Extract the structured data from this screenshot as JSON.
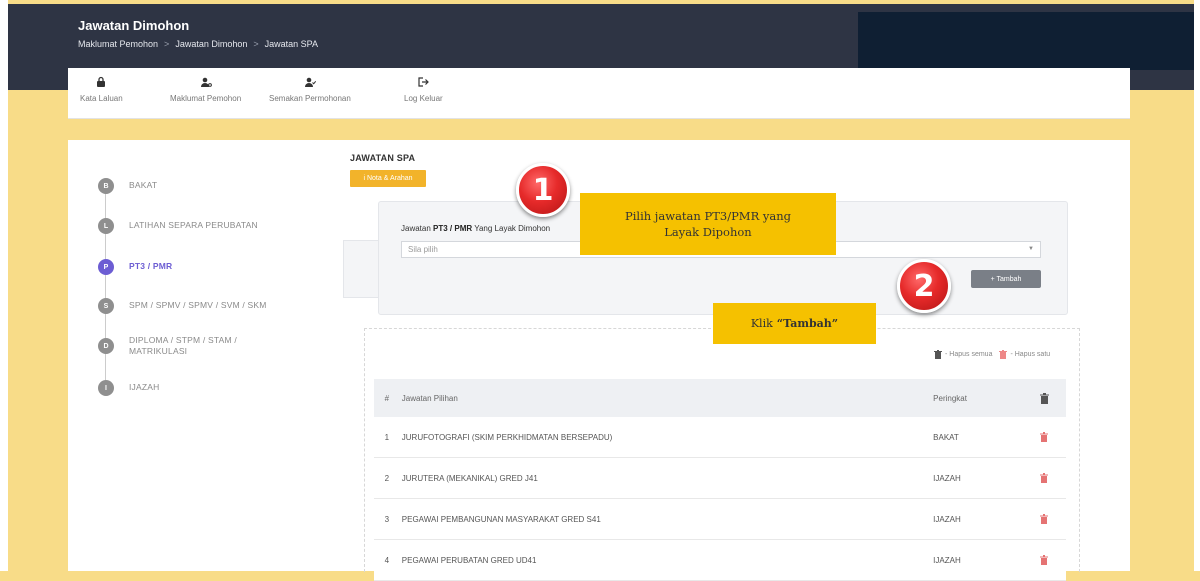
{
  "header": {
    "title": "Jawatan Dimohon",
    "breadcrumb": [
      "Maklumat Pemohon",
      "Jawatan Dimohon",
      "Jawatan SPA"
    ],
    "breadcrumb_separator": ">"
  },
  "nav": {
    "items": [
      {
        "label": "Kata Laluan",
        "icon": "lock-icon"
      },
      {
        "label": "Maklumat Pemohon",
        "icon": "user-settings-icon"
      },
      {
        "label": "Semakan Permohonan",
        "icon": "user-check-icon"
      },
      {
        "label": "Log Keluar",
        "icon": "logout-icon"
      }
    ]
  },
  "steps": [
    {
      "letter": "B",
      "label": "BAKAT"
    },
    {
      "letter": "L",
      "label": "LATIHAN SEPARA PERUBATAN"
    },
    {
      "letter": "P",
      "label": "PT3 / PMR",
      "active": true
    },
    {
      "letter": "S",
      "label": "SPM / SPMV / SPMV / SVM / SKM"
    },
    {
      "letter": "D",
      "label_line1": "DIPLOMA / STPM / STAM /",
      "label_line2": "MATRIKULASI"
    },
    {
      "letter": "I",
      "label": "IJAZAH"
    }
  ],
  "main": {
    "section_title": "JAWATAN SPA",
    "nota_button": "i Nota & Arahan",
    "field_label_prefix": "Jawatan ",
    "field_label_bold": "PT3 / PMR",
    "field_label_suffix": " Yang Layak Dimohon",
    "select_placeholder": "Sila pilih",
    "tambah_button": "+ Tambah"
  },
  "legend": {
    "hapus_semua": "- Hapus semua",
    "hapus_satu": "- Hapus satu"
  },
  "table": {
    "headers": {
      "no": "#",
      "name": "Jawatan Pilihan",
      "rank": "Peringkat"
    },
    "rows": [
      {
        "no": "1",
        "name": "JURUFOTOGRAFI (SKIM PERKHIDMATAN BERSEPADU)",
        "rank": "BAKAT"
      },
      {
        "no": "2",
        "name": "JURUTERA (MEKANIKAL) GRED J41",
        "rank": "IJAZAH"
      },
      {
        "no": "3",
        "name": "PEGAWAI PEMBANGUNAN MASYARAKAT GRED S41",
        "rank": "IJAZAH"
      },
      {
        "no": "4",
        "name": "PEGAWAI PERUBATAN GRED UD41",
        "rank": "IJAZAH"
      }
    ]
  },
  "annotations": {
    "callout1_line1": "Pilih jawatan PT3/PMR yang",
    "callout1_line2": "Layak Dipohon",
    "callout2_prefix": "Klik",
    "callout2_bold": "“Tambah”",
    "badge1": "1",
    "badge2": "2"
  },
  "colors": {
    "header_bg": "#2e3444",
    "page_bg": "#f8dc88",
    "accent_yellow": "#f2b32a",
    "active_step": "#6c5dd3",
    "delete_red": "#e05a5a",
    "callout": "#f5c100",
    "badge_red": "#e62a2a"
  }
}
